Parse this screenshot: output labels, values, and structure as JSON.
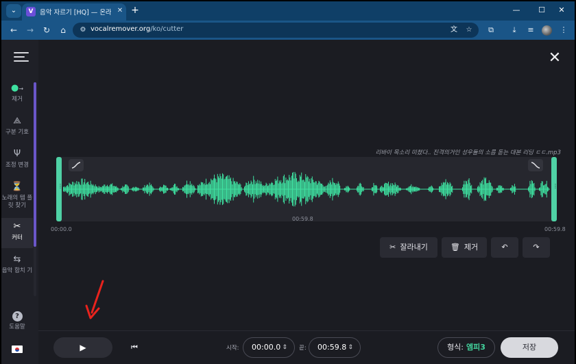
{
  "browser": {
    "tab_title": "음악 자르기 [HQ] — 온라인 오",
    "favicon_letter": "V",
    "url_host": "vocalremover.org",
    "url_path": "/ko/cutter"
  },
  "sidebar": {
    "items": [
      {
        "label": "제거",
        "icon": "remove-icon"
      },
      {
        "label": "구분 기호",
        "icon": "splitter-icon"
      },
      {
        "label": "조정 변경",
        "icon": "tuning-fork-icon"
      },
      {
        "label": "노래의 템 플릿 찾기",
        "icon": "metronome-icon"
      },
      {
        "label": "커터",
        "icon": "scissors-icon"
      },
      {
        "label": "음악 합치 기",
        "icon": "joiner-icon"
      },
      {
        "label": "도움말",
        "icon": "help-icon"
      }
    ],
    "accent": "#6a56c8"
  },
  "editor": {
    "filename": "리바이 목소리 미쳤다.. 진격의거인 성우들의 소름 돋는 대본 리딩 ㄷㄷ.mp3",
    "start_marker": "00:00.0",
    "mid_marker": "00:59.8",
    "end_marker": "00:59.8",
    "wave_color": "#3ee0a0",
    "buttons": {
      "cut": "잘라내기",
      "delete": "제거"
    }
  },
  "bottom": {
    "start_label": "시작:",
    "start_value": "00:00.0",
    "end_label": "끝:",
    "end_value": "00:59.8",
    "format_label": "형식:",
    "format_value": "엠피3",
    "save_label": "저장"
  }
}
